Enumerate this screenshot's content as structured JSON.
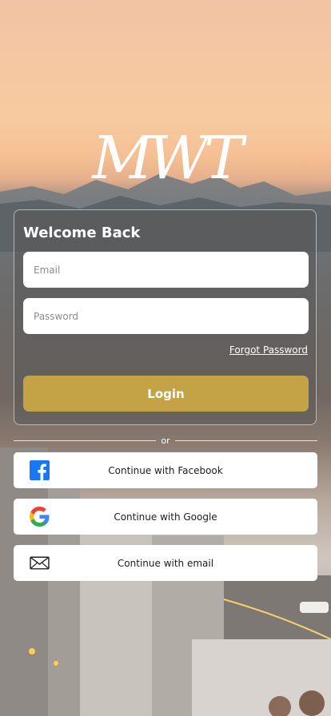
{
  "logo": {
    "text": "MWT"
  },
  "login_card": {
    "title": "Welcome Back",
    "email_placeholder": "Email",
    "password_placeholder": "Password",
    "forgot_label": "Forgot Password",
    "login_label": "Login"
  },
  "divider": {
    "text": "or"
  },
  "social": {
    "facebook_label": "Continue with Facebook",
    "google_label": "Continue with Google",
    "email_label": "Continue with email"
  },
  "colors": {
    "accent": "#c4a347",
    "facebook": "#1877f2"
  }
}
